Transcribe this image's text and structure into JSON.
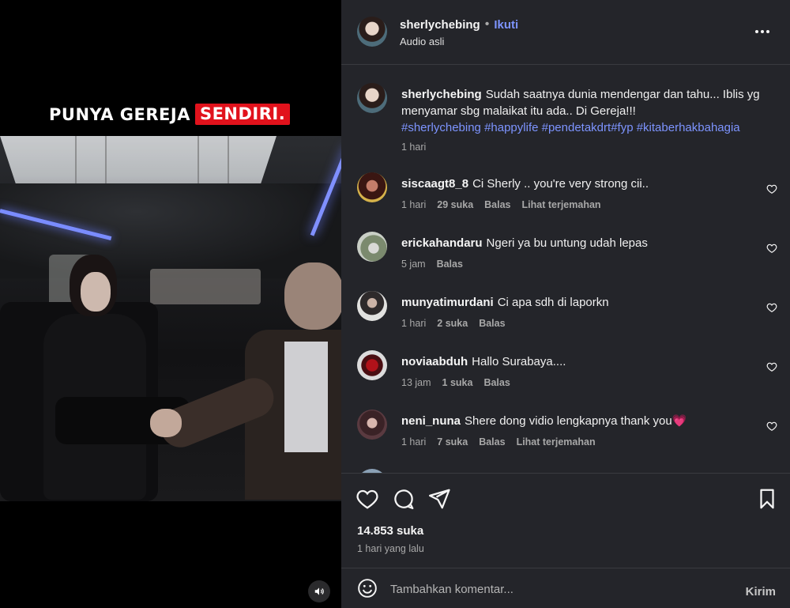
{
  "video": {
    "caption_part1": "PUNYA GEREJA",
    "caption_highlight": "SENDIRI.",
    "mute_icon": "speaker-icon"
  },
  "header": {
    "username": "sherlychebing",
    "separator": "•",
    "follow_label": "Ikuti",
    "audio_label": "Audio asli",
    "more_icon": "more-horizontal-icon"
  },
  "caption_post": {
    "username": "sherlychebing",
    "text": "Sudah saatnya dunia mendengar dan tahu... Iblis yg menyamar sbg malaikat itu ada.. Di Gereja!!!",
    "hashtags": "#sherlychebing #happylife #pendetakdrt#fyp #kitaberhakbahagia",
    "time": "1 hari"
  },
  "comments": [
    {
      "username": "siscaagt8_8",
      "text": "Ci Sherly .. you're very strong cii..",
      "time": "1 hari",
      "likes": "29 suka",
      "reply": "Balas",
      "translate": "Lihat terjemahan"
    },
    {
      "username": "erickahandaru",
      "text": "Ngeri ya bu untung udah lepas",
      "time": "5 jam",
      "likes": "",
      "reply": "Balas",
      "translate": ""
    },
    {
      "username": "munyatimurdani",
      "text": "Ci apa sdh di laporkn",
      "time": "1 hari",
      "likes": "2 suka",
      "reply": "Balas",
      "translate": ""
    },
    {
      "username": "noviaabduh",
      "text": "Hallo Surabaya....",
      "time": "13 jam",
      "likes": "1 suka",
      "reply": "Balas",
      "translate": ""
    },
    {
      "username": "neni_nuna",
      "text": "Shere dong vidio lengkapnya thank you",
      "emoji": "💗",
      "time": "1 hari",
      "likes": "7 suka",
      "reply": "Balas",
      "translate": "Lihat terjemahan"
    }
  ],
  "actions": {
    "like_icon": "heart-icon",
    "comment_icon": "comment-icon",
    "share_icon": "send-icon",
    "save_icon": "bookmark-icon",
    "likes_count": "14.853 suka",
    "posted": "1 hari yang lalu"
  },
  "composer": {
    "emoji_icon": "smiley-icon",
    "placeholder": "Tambahkan komentar...",
    "send_label": "Kirim"
  },
  "colors": {
    "panel_bg": "#24252a",
    "link": "#7d94ff",
    "caption_red": "#e1121c"
  }
}
